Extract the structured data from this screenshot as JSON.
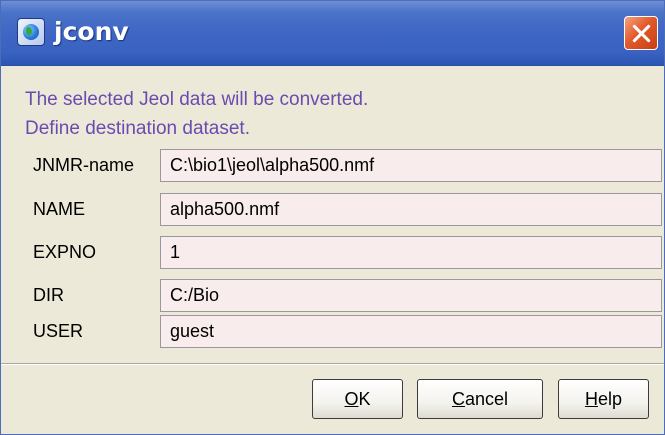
{
  "window": {
    "title": "jconv",
    "app_icon": "globe-icon",
    "close_icon": "close-icon"
  },
  "message": {
    "line1": "The selected Jeol data will be converted.",
    "line2": "Define destination dataset."
  },
  "fields": [
    {
      "label": "JNMR-name",
      "value": "C:\\bio1\\jeol\\alpha500.nmf"
    },
    {
      "label": "NAME",
      "value": "alpha500.nmf"
    },
    {
      "label": "EXPNO",
      "value": "1"
    },
    {
      "label": "DIR",
      "value": "C:/Bio"
    },
    {
      "label": "USER",
      "value": "guest"
    }
  ],
  "buttons": {
    "ok": {
      "mnemonic": "O",
      "rest": "K"
    },
    "cancel": {
      "mnemonic": "C",
      "rest": "ancel"
    },
    "help": {
      "mnemonic": "H",
      "rest": "elp"
    }
  },
  "colors": {
    "title_bar": "#3f66c4",
    "message_text": "#6a4bb0",
    "field_background": "#f8ecec",
    "close_button": "#e2592b",
    "dialog_background": "#ece9d8"
  }
}
